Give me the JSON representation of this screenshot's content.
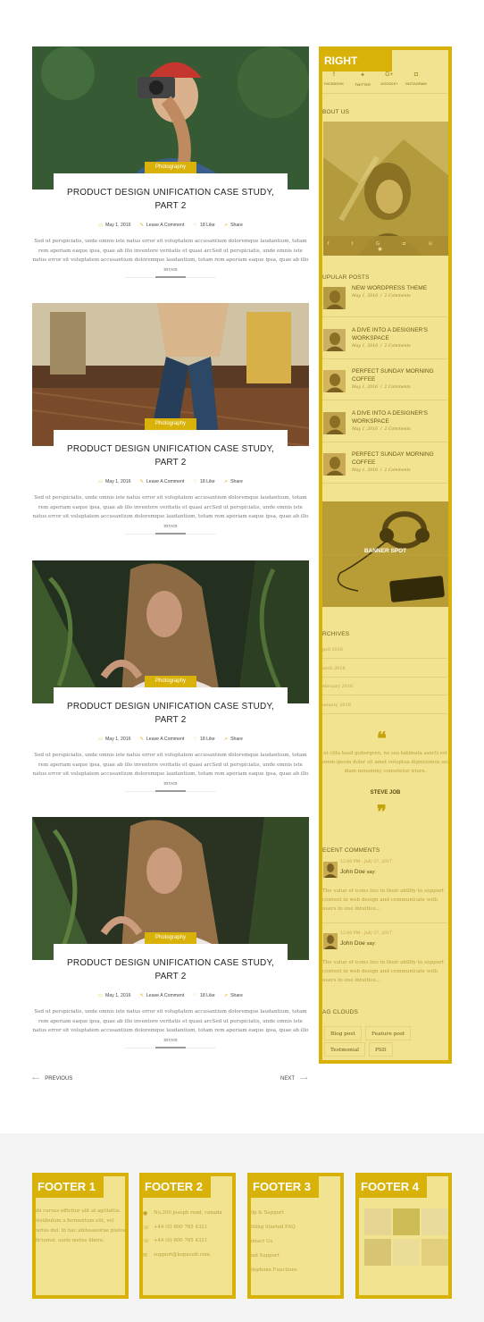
{
  "posts": [
    {
      "category": "Photography",
      "title_line1": "PRODUCT DESIGN UNIFICATION CASE STUDY,",
      "title_line2": "PART 2",
      "date": "May 1, 2016",
      "comments": "Leave A Comment",
      "likes": "18 Like",
      "share": "Share",
      "excerpt": "Sed ut perspiciatis, unde omnis iste natus error sit voluptatem accusantium doloremque laudantium, totam rem aperiam eaque ipsa, quae ab illo inventore veritatis et quasi arcSed ut perspiciatis, unde omnis iste natus error sit voluptatem accusantium doloremque laudantium, totam rem aperiam eaque ipsa, quae ab illo inven"
    },
    {
      "category": "Photography",
      "title_line1": "PRODUCT DESIGN UNIFICATION CASE STUDY,",
      "title_line2": "PART 2",
      "date": "May 1, 2016",
      "comments": "Leave A Comment",
      "likes": "18 Like",
      "share": "Share",
      "excerpt": "Sed ut perspiciatis, unde omnis iste natus error sit voluptatem accusantium doloremque laudantium, totam rem aperiam eaque ipsa, quae ab illo inventore veritatis et quasi arcSed ut perspiciatis, unde omnis iste natus error sit voluptatem accusantium doloremque laudantium, totam rem aperiam eaque ipsa, quae ab illo inven"
    },
    {
      "category": "Photography",
      "title_line1": "PRODUCT DESIGN UNIFICATION CASE STUDY,",
      "title_line2": "PART 2",
      "date": "May 1, 2016",
      "comments": "Leave A Comment",
      "likes": "18 Like",
      "share": "Share",
      "excerpt": "Sed ut perspiciatis, unde omnis iste natus error sit voluptatem accusantium doloremque laudantium, totam rem aperiam eaque ipsa, quae ab illo inventore veritatis et quasi arcSed ut perspiciatis, unde omnis iste natus error sit voluptatem accusantium doloremque laudantium, totam rem aperiam eaque ipsa, quae ab illo inven"
    },
    {
      "category": "Photography",
      "title_line1": "PRODUCT DESIGN UNIFICATION CASE STUDY,",
      "title_line2": "PART 2",
      "date": "May 1, 2016",
      "comments": "Leave A Comment",
      "likes": "18 Like",
      "share": "Share",
      "excerpt": "Sed ut perspiciatis, unde omnis iste natus error sit voluptatem accusantium doloremque laudantium, totam rem aperiam eaque ipsa, quae ab illo inventore veritatis et quasi arcSed ut perspiciatis, unde omnis iste natus error sit voluptatem accusantium doloremque laudantium, totam rem aperiam eaque ipsa, quae ab illo inven"
    }
  ],
  "pagination": {
    "previous": "PREVIOUS",
    "next": "NEXT"
  },
  "sidebar": {
    "tag": "RIGHT",
    "social": [
      {
        "label": "FACEBOOK",
        "icon": "f"
      },
      {
        "label": "TWITTER",
        "icon": "t"
      },
      {
        "label": "GOOGLE+",
        "icon": "G+"
      },
      {
        "label": "INSTAGRAM",
        "icon": "ig"
      }
    ],
    "about_heading": "BOUT US",
    "popular_heading": "UPULAR POSTS",
    "popular": [
      {
        "title": "NEW WORDPRESS THEME",
        "date": "May 1, 2016",
        "comments": "2 Comments"
      },
      {
        "title": "A DIVE INTO A DESIGNER'S WORKSPACE",
        "date": "May 1, 2016",
        "comments": "2 Comments"
      },
      {
        "title": "PERFECT SUNDAY MORNING COFFEE",
        "date": "May 1, 2016",
        "comments": "2 Comments"
      },
      {
        "title": "A DIVE INTO A DESIGNER'S WORKSPACE",
        "date": "May 1, 2016",
        "comments": "2 Comments"
      },
      {
        "title": "PERFECT SUNDAY MORNING COFFEE",
        "date": "May 1, 2016",
        "comments": "2 Comments"
      }
    ],
    "banner_label": "BANNER SPOT",
    "archives_heading": "RCHIVES",
    "archives": [
      "pril 2016",
      "arch 2016",
      "ebruary 2016",
      "anuary 2016"
    ],
    "quote_text": "et clita kasd gubergren, no sea takimata sancti est lorem ipsum dolor sit amet voluptua dignissimos sed diam nonummy consetetur iriure.",
    "quote_author": "STEVE JOB",
    "comments_heading": "ECENT COMMENTS",
    "comments": [
      {
        "date": "12:00 PM - July 27, 2017",
        "name": "John Doe",
        "says": "say:",
        "text": "The value of icons lies in their ability to support content in web design and communicate with users in one intuitive..."
      },
      {
        "date": "12:00 PM - July 27, 2017",
        "name": "John Doe",
        "says": "say:",
        "text": "The value of icons lies in their ability to support content in web design and communicate with users in one intuitive..."
      }
    ],
    "tags_heading": "AG CLOUDS",
    "tags": [
      "Blog post",
      "Feature post",
      "Testmonial",
      "PSD"
    ]
  },
  "footer": {
    "col1": {
      "tag": "FOOTER 1",
      "text": "obi cursus efficitur elit at agittattis. Vestibulum a fermentum elit, vel varius dui. In hac abitasseorae platea dictumst. auris metus libero."
    },
    "col2": {
      "tag": "FOOTER 2",
      "address": "No.200 joseph road, canada",
      "phone1": "+44 (0) 800 765 4321",
      "phone2": "+44 (0) 800 765 4321",
      "email": "support@kopasoft.com"
    },
    "col3": {
      "tag": "FOOTER 3",
      "links": [
        "elp & Support",
        "etting Started FAQ",
        "ontact Us",
        "eed Support",
        "elephone Functions"
      ]
    },
    "col4": {
      "tag": "FOOTER 4"
    }
  }
}
